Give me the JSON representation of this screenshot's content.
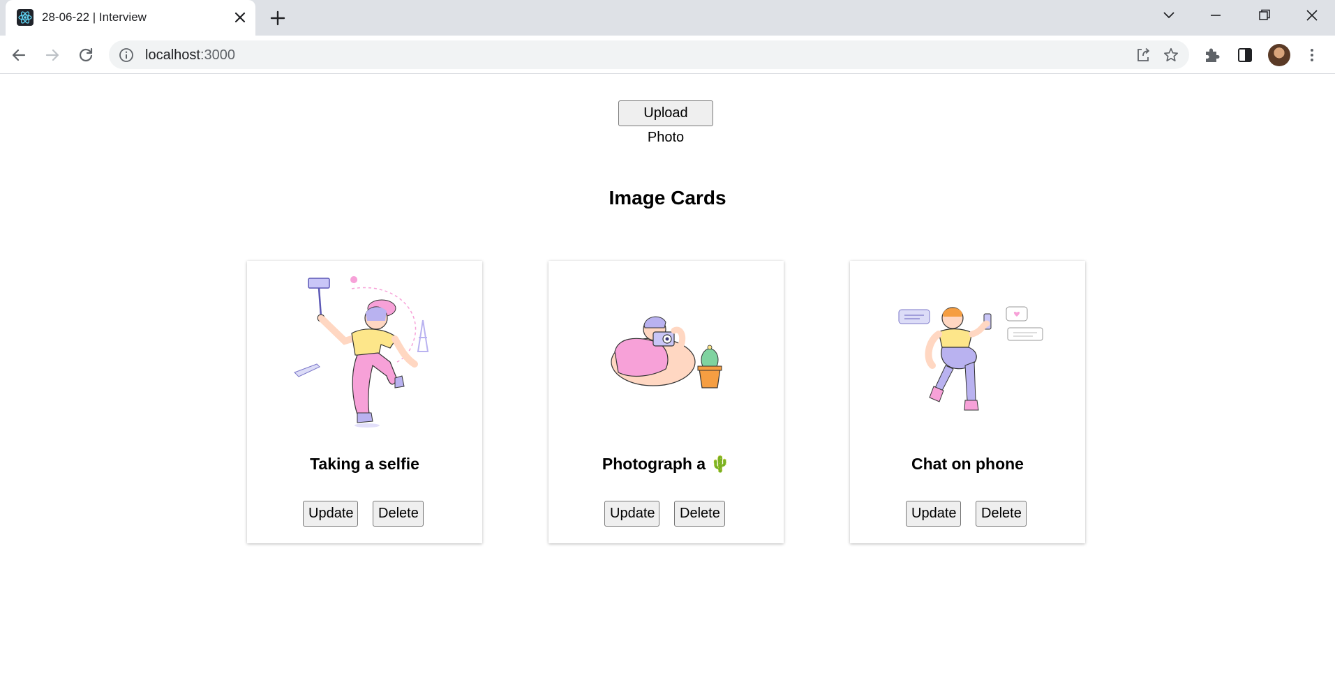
{
  "browser": {
    "tab_title": "28-06-22 | Interview",
    "url_host": "localhost",
    "url_port": ":3000",
    "icons": {
      "favicon": "react-logo-icon",
      "tab_close": "close-icon",
      "new_tab": "plus-icon",
      "tab_search": "chevron-down-icon",
      "minimize": "minimize-icon",
      "restore": "restore-icon",
      "close_window": "close-icon",
      "back": "arrow-left-icon",
      "forward": "arrow-right-icon",
      "reload": "reload-icon",
      "site_info": "info-icon",
      "share": "share-icon",
      "bookmark": "star-icon",
      "extensions": "puzzle-icon",
      "side_panel": "side-panel-icon",
      "menu": "kebab-menu-icon"
    }
  },
  "page": {
    "upload_label": "Upload Photo",
    "heading": "Image Cards",
    "cards": [
      {
        "title": "Taking a selfie",
        "update_label": "Update",
        "delete_label": "Delete",
        "illustration": "selfie-illustration"
      },
      {
        "title": "Photograph a 🌵",
        "update_label": "Update",
        "delete_label": "Delete",
        "illustration": "photograph-cactus-illustration"
      },
      {
        "title": "Chat on phone",
        "update_label": "Update",
        "delete_label": "Delete",
        "illustration": "chat-phone-illustration"
      }
    ]
  },
  "colors": {
    "tabstrip": "#dee1e6",
    "omnibox": "#f1f3f4",
    "button_bg": "#efefef",
    "button_border": "#767676",
    "pink": "#f7a1d8",
    "yellow": "#fde68a",
    "lavender": "#b9b2f0"
  }
}
